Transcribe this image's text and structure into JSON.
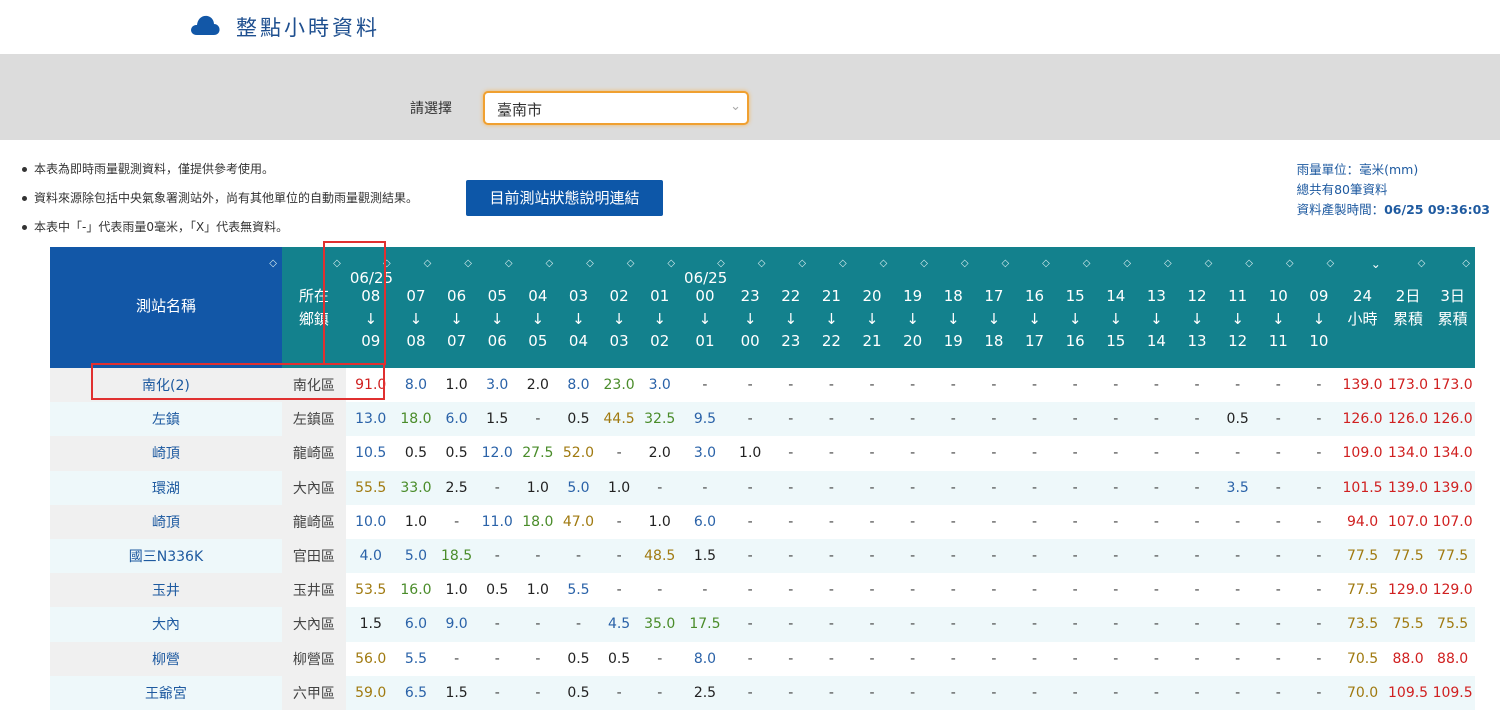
{
  "header": {
    "title": "整點小時資料",
    "icon": "cloud-icon"
  },
  "selector": {
    "label": "請選擇",
    "value": "臺南市"
  },
  "notes": [
    "本表為即時雨量觀測資料，僅提供參考使用。",
    "資料來源除包括中央氣象署測站外，尚有其他單位的自動雨量觀測結果。",
    "本表中「-」代表雨量0毫米，「X」代表無資料。"
  ],
  "status_button": "目前測站狀態說明連結",
  "info": {
    "unit": "雨量單位：毫米(mm)",
    "total": "總共有80筆資料",
    "time_label": "資料產製時間：",
    "time_value": "06/25 09:36:03"
  },
  "table": {
    "headers": [
      {
        "l1": "",
        "l2": "測站名稱",
        "l3": "",
        "l4": ""
      },
      {
        "l1": "",
        "l2": "所在",
        "l3": "鄉鎮",
        "l4": ""
      },
      {
        "l1": "06/25",
        "l2": "08",
        "l3": "↓",
        "l4": "09"
      },
      {
        "l1": "",
        "l2": "07",
        "l3": "↓",
        "l4": "08"
      },
      {
        "l1": "",
        "l2": "06",
        "l3": "↓",
        "l4": "07"
      },
      {
        "l1": "",
        "l2": "05",
        "l3": "↓",
        "l4": "06"
      },
      {
        "l1": "",
        "l2": "04",
        "l3": "↓",
        "l4": "05"
      },
      {
        "l1": "",
        "l2": "03",
        "l3": "↓",
        "l4": "04"
      },
      {
        "l1": "",
        "l2": "02",
        "l3": "↓",
        "l4": "03"
      },
      {
        "l1": "",
        "l2": "01",
        "l3": "↓",
        "l4": "02"
      },
      {
        "l1": "06/25",
        "l2": "00",
        "l3": "↓",
        "l4": "01"
      },
      {
        "l1": "",
        "l2": "23",
        "l3": "↓",
        "l4": "00"
      },
      {
        "l1": "",
        "l2": "22",
        "l3": "↓",
        "l4": "23"
      },
      {
        "l1": "",
        "l2": "21",
        "l3": "↓",
        "l4": "22"
      },
      {
        "l1": "",
        "l2": "20",
        "l3": "↓",
        "l4": "21"
      },
      {
        "l1": "",
        "l2": "19",
        "l3": "↓",
        "l4": "20"
      },
      {
        "l1": "",
        "l2": "18",
        "l3": "↓",
        "l4": "19"
      },
      {
        "l1": "",
        "l2": "17",
        "l3": "↓",
        "l4": "18"
      },
      {
        "l1": "",
        "l2": "16",
        "l3": "↓",
        "l4": "17"
      },
      {
        "l1": "",
        "l2": "15",
        "l3": "↓",
        "l4": "16"
      },
      {
        "l1": "",
        "l2": "14",
        "l3": "↓",
        "l4": "15"
      },
      {
        "l1": "",
        "l2": "13",
        "l3": "↓",
        "l4": "14"
      },
      {
        "l1": "",
        "l2": "12",
        "l3": "↓",
        "l4": "13"
      },
      {
        "l1": "",
        "l2": "11",
        "l3": "↓",
        "l4": "12"
      },
      {
        "l1": "",
        "l2": "10",
        "l3": "↓",
        "l4": "11"
      },
      {
        "l1": "",
        "l2": "09",
        "l3": "↓",
        "l4": "10"
      },
      {
        "l1": "",
        "l2": "24",
        "l3": "小時",
        "l4": ""
      },
      {
        "l1": "",
        "l2": "2日",
        "l3": "累積",
        "l4": ""
      },
      {
        "l1": "",
        "l2": "3日",
        "l3": "累積",
        "l4": ""
      }
    ],
    "sorted_column": 26,
    "rows": [
      {
        "station": "南化(2)",
        "town": "南化區",
        "values": [
          "91.0",
          "8.0",
          "1.0",
          "3.0",
          "2.0",
          "8.0",
          "23.0",
          "3.0",
          "-",
          "-",
          "-",
          "-",
          "-",
          "-",
          "-",
          "-",
          "-",
          "-",
          "-",
          "-",
          "-",
          "-",
          "-",
          "-",
          "139.0",
          "173.0",
          "173.0"
        ]
      },
      {
        "station": "左鎮",
        "town": "左鎮區",
        "values": [
          "13.0",
          "18.0",
          "6.0",
          "1.5",
          "-",
          "0.5",
          "44.5",
          "32.5",
          "9.5",
          "-",
          "-",
          "-",
          "-",
          "-",
          "-",
          "-",
          "-",
          "-",
          "-",
          "-",
          "-",
          "0.5",
          "-",
          "-",
          "126.0",
          "126.0",
          "126.0"
        ]
      },
      {
        "station": "崎頂",
        "town": "龍崎區",
        "values": [
          "10.5",
          "0.5",
          "0.5",
          "12.0",
          "27.5",
          "52.0",
          "-",
          "2.0",
          "3.0",
          "1.0",
          "-",
          "-",
          "-",
          "-",
          "-",
          "-",
          "-",
          "-",
          "-",
          "-",
          "-",
          "-",
          "-",
          "-",
          "109.0",
          "134.0",
          "134.0"
        ]
      },
      {
        "station": "環湖",
        "town": "大內區",
        "values": [
          "55.5",
          "33.0",
          "2.5",
          "-",
          "1.0",
          "5.0",
          "1.0",
          "-",
          "-",
          "-",
          "-",
          "-",
          "-",
          "-",
          "-",
          "-",
          "-",
          "-",
          "-",
          "-",
          "-",
          "3.5",
          "-",
          "-",
          "101.5",
          "139.0",
          "139.0"
        ]
      },
      {
        "station": "崎頂",
        "town": "龍崎區",
        "values": [
          "10.0",
          "1.0",
          "-",
          "11.0",
          "18.0",
          "47.0",
          "-",
          "1.0",
          "6.0",
          "-",
          "-",
          "-",
          "-",
          "-",
          "-",
          "-",
          "-",
          "-",
          "-",
          "-",
          "-",
          "-",
          "-",
          "-",
          "94.0",
          "107.0",
          "107.0"
        ]
      },
      {
        "station": "國三N336K",
        "town": "官田區",
        "values": [
          "4.0",
          "5.0",
          "18.5",
          "-",
          "-",
          "-",
          "-",
          "48.5",
          "1.5",
          "-",
          "-",
          "-",
          "-",
          "-",
          "-",
          "-",
          "-",
          "-",
          "-",
          "-",
          "-",
          "-",
          "-",
          "-",
          "77.5",
          "77.5",
          "77.5"
        ]
      },
      {
        "station": "玉井",
        "town": "玉井區",
        "values": [
          "53.5",
          "16.0",
          "1.0",
          "0.5",
          "1.0",
          "5.5",
          "-",
          "-",
          "-",
          "-",
          "-",
          "-",
          "-",
          "-",
          "-",
          "-",
          "-",
          "-",
          "-",
          "-",
          "-",
          "-",
          "-",
          "-",
          "77.5",
          "129.0",
          "129.0"
        ]
      },
      {
        "station": "大內",
        "town": "大內區",
        "values": [
          "1.5",
          "6.0",
          "9.0",
          "-",
          "-",
          "-",
          "4.5",
          "35.0",
          "17.5",
          "-",
          "-",
          "-",
          "-",
          "-",
          "-",
          "-",
          "-",
          "-",
          "-",
          "-",
          "-",
          "-",
          "-",
          "-",
          "73.5",
          "75.5",
          "75.5"
        ]
      },
      {
        "station": "柳營",
        "town": "柳營區",
        "values": [
          "56.0",
          "5.5",
          "-",
          "-",
          "-",
          "0.5",
          "0.5",
          "-",
          "8.0",
          "-",
          "-",
          "-",
          "-",
          "-",
          "-",
          "-",
          "-",
          "-",
          "-",
          "-",
          "-",
          "-",
          "-",
          "-",
          "70.5",
          "88.0",
          "88.0"
        ]
      },
      {
        "station": "王爺宮",
        "town": "六甲區",
        "values": [
          "59.0",
          "6.5",
          "1.5",
          "-",
          "-",
          "0.5",
          "-",
          "-",
          "2.5",
          "-",
          "-",
          "-",
          "-",
          "-",
          "-",
          "-",
          "-",
          "-",
          "-",
          "-",
          "-",
          "-",
          "-",
          "-",
          "70.0",
          "109.5",
          "109.5"
        ]
      }
    ]
  },
  "colors": {
    "header_teal": "#13818d",
    "header_blue": "#1257a7",
    "highlight_red": "#e03030",
    "select_orange": "#f0a030"
  }
}
